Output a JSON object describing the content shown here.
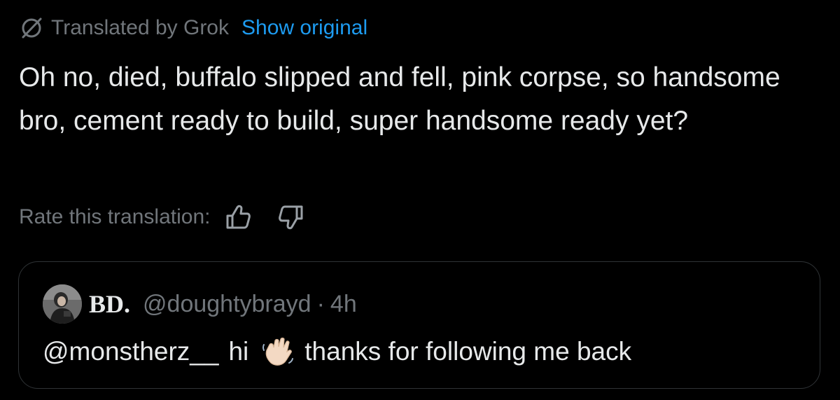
{
  "translation_bar": {
    "label": "Translated by Grok",
    "show_original": "Show original",
    "icon": "grok-slash-icon"
  },
  "tweet": {
    "text": "Oh no, died, buffalo slipped and fell, pink corpse, so handsome bro, cement ready to build, super handsome ready yet?"
  },
  "rating": {
    "label": "Rate this translation:",
    "thumbs_up_icon": "thumbs-up-icon",
    "thumbs_down_icon": "thumbs-down-icon"
  },
  "quote": {
    "author_name": "BD.",
    "handle": "@doughtybrayd",
    "separator": "·",
    "timestamp": "4h",
    "mention": "@monstherz__",
    "greeting": "hi",
    "emoji": "waving-hand-icon",
    "body_rest": "thanks for following me back"
  },
  "colors": {
    "background": "#000000",
    "text_primary": "#e7e9ea",
    "text_secondary": "#71767b",
    "link": "#1d9bf0",
    "border": "#2f3336"
  }
}
